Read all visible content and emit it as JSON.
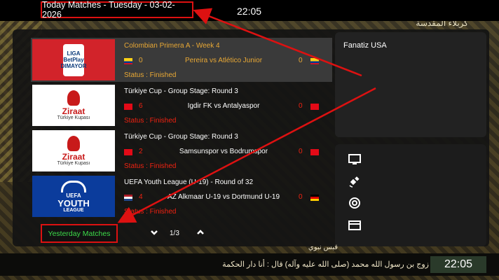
{
  "header": {
    "date": "Today Matches - Tuesday - 03-02-2026",
    "clock": "22:05"
  },
  "background": {
    "arabic_title": "كربلاء المقدسة"
  },
  "matches": [
    {
      "title": "Colombian Primera A - Week 4",
      "home_score": "0",
      "teams": "Pereira vs Atlético Junior",
      "away_score": "0",
      "status": "Status : Finished",
      "logo": "BetPlay"
    },
    {
      "title": "Türkiye Cup - Group Stage: Round 3",
      "home_score": "6",
      "teams": "Igdir FK vs Antalyaspor",
      "away_score": "0",
      "status": "Status : Finished",
      "logo": "Ziraat"
    },
    {
      "title": "Türkiye Cup - Group Stage: Round 3",
      "home_score": "2",
      "teams": "Samsunspor vs Bodrumspor",
      "away_score": "0",
      "status": "Status : Finished",
      "logo": "Ziraat"
    },
    {
      "title": "UEFA Youth League (U-19) - Round of 32",
      "home_score": "4",
      "teams": "AZ Alkmaar U-19 vs Dortmund U-19",
      "away_score": "0",
      "status": "Status : Finished",
      "logo": "UEFA Youth League"
    }
  ],
  "logos": {
    "betplay": {
      "l1": "LIGA",
      "l2": "BetPlay",
      "l3": "DIMAYOR"
    },
    "ziraat": {
      "l1": "Ziraat",
      "l2": "Türkiye Kupası"
    },
    "uefa": {
      "l1": "UEFA",
      "l2": "YOUTH",
      "l3": "LEAGUE"
    }
  },
  "right_card": {
    "title": "Fanatiz USA"
  },
  "footer": {
    "yesterday_label": "Yesterday Matches",
    "page": "1/3"
  },
  "ticker": {
    "text": "زوج بن رسول الله محمد (صلى الله عليه وآله) قال : أنا دار الحكمة",
    "sub": "قبس نبوي",
    "clock": "22:05"
  },
  "icons": [
    "tv-icon",
    "satellite-icon",
    "at-sign-icon",
    "card-icon"
  ],
  "colors": {
    "accent": "#e8a835",
    "annotation": "#dd1111",
    "status_red": "#ee2211",
    "yesterday_green": "#3ddc4a"
  }
}
